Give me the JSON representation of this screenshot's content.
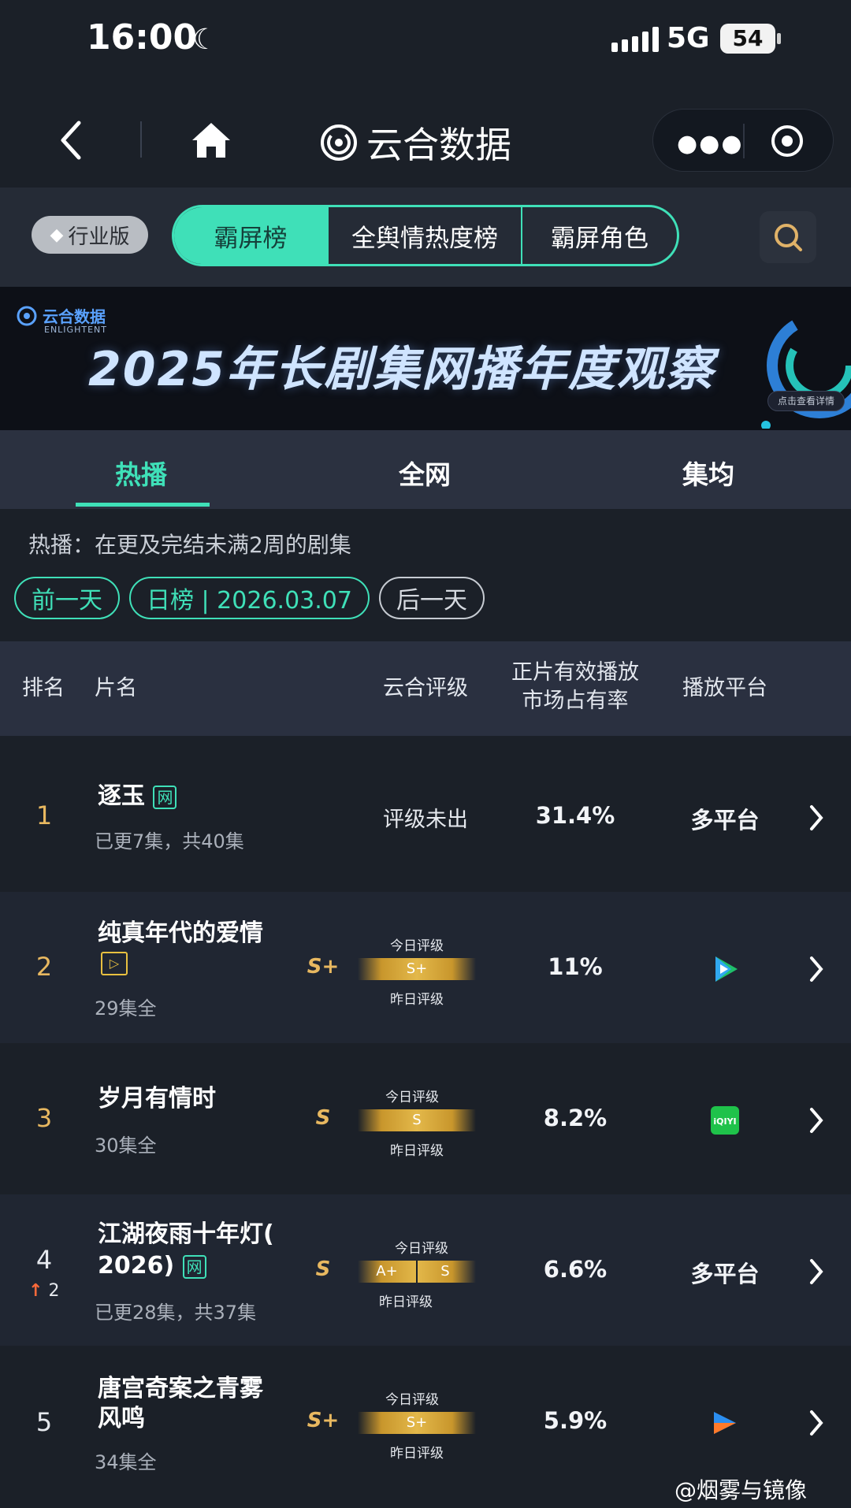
{
  "status_bar": {
    "time": "16:00",
    "network": "5G",
    "battery": "54"
  },
  "nav": {
    "brand": "云合数据"
  },
  "filter": {
    "edition_label": "行业版",
    "tabs": [
      {
        "label": "霸屏榜",
        "active": true
      },
      {
        "label": "全舆情热度榜"
      },
      {
        "label": "霸屏角色"
      }
    ]
  },
  "banner": {
    "logo_text": "云合数据",
    "logo_sub": "ENLIGHTENT",
    "title": "2025年长剧集网播年度观察",
    "link": "点击查看详情"
  },
  "scope_tabs": [
    {
      "label": "热播",
      "active": true
    },
    {
      "label": "全网"
    },
    {
      "label": "集均"
    }
  ],
  "description": "热播：在更及完结未满2周的剧集",
  "date_nav": {
    "prev": "前一天",
    "current": "日榜 | 2026.03.07",
    "next": "后一天"
  },
  "table": {
    "headers": {
      "rank": "排名",
      "title": "片名",
      "rating": "云合评级",
      "share_line1": "正片有效播放",
      "share_line2": "市场占有率",
      "platform": "播放平台"
    },
    "today_label": "今日评级",
    "yesterday_label": "昨日评级",
    "rows": [
      {
        "rank": "1",
        "title": "逐玉",
        "tag": "网",
        "episodes": "已更7集，共40集",
        "rating": "评级未出",
        "share": "31.4%",
        "platform": "多平台"
      },
      {
        "rank": "2",
        "title": "纯真年代的爱情",
        "tag": "▷",
        "episodes": "29集全",
        "grade": "S+",
        "bar": "S+",
        "share": "11%",
        "platform_icon": "tencent-video-icon"
      },
      {
        "rank": "3",
        "title": "岁月有情时",
        "episodes": "30集全",
        "grade": "S",
        "bar": "S",
        "share": "8.2%",
        "platform_icon": "iqiyi-icon"
      },
      {
        "rank": "4",
        "title_line1": "江湖夜雨十年灯(",
        "title_line2": "2026)",
        "tag": "网",
        "rank_change": "2",
        "episodes": "已更28集，共37集",
        "grade": "S",
        "bar_left": "A+",
        "bar_right": "S",
        "share": "6.6%",
        "platform": "多平台"
      },
      {
        "rank": "5",
        "title_line1": "唐宫奇案之青雾",
        "title_line2": "风鸣",
        "episodes": "34集全",
        "grade": "S+",
        "bar": "S+",
        "share": "5.9%",
        "platform_icon": "youku-icon"
      }
    ]
  },
  "watermark": "@烟雾与镜像",
  "colors": {
    "accent": "#3fe0b8",
    "gold": "#e3b84a",
    "rank_top3": "#e8b860",
    "background": "#1b2028"
  }
}
